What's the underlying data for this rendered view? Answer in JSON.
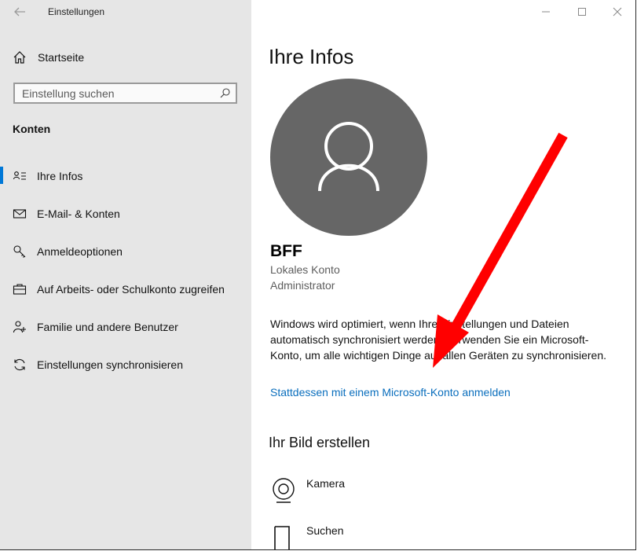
{
  "window": {
    "title": "Einstellungen"
  },
  "sidebar": {
    "home_label": "Startseite",
    "search_placeholder": "Einstellung suchen",
    "section_title": "Konten",
    "items": [
      {
        "label": "Ihre Infos",
        "icon": "person-card-icon",
        "active": true
      },
      {
        "label": "E-Mail- & Konten",
        "icon": "mail-icon",
        "active": false
      },
      {
        "label": "Anmeldeoptionen",
        "icon": "key-icon",
        "active": false
      },
      {
        "label": "Auf Arbeits- oder Schulkonto zugreifen",
        "icon": "briefcase-icon",
        "active": false
      },
      {
        "label": "Familie und andere Benutzer",
        "icon": "person-add-icon",
        "active": false
      },
      {
        "label": "Einstellungen synchronisieren",
        "icon": "sync-icon",
        "active": false
      }
    ]
  },
  "main": {
    "title": "Ihre Infos",
    "user_name": "BFF",
    "account_type": "Lokales Konto",
    "account_role": "Administrator",
    "description": "Windows wird optimiert, wenn Ihre Einstellungen und Dateien automatisch synchronisiert werden. Verwenden Sie ein Microsoft-Konto, um alle wichtigen Dinge auf allen Geräten zu synchronisieren.",
    "ms_link": "Stattdessen mit einem Microsoft-Konto anmelden",
    "create_picture_title": "Ihr Bild erstellen",
    "options": [
      {
        "label": "Kamera",
        "icon": "camera-icon"
      },
      {
        "label": "Suchen",
        "icon": "browse-icon"
      }
    ]
  },
  "colors": {
    "accent": "#0078d7",
    "link": "#0a6ebd",
    "avatar": "#666666",
    "annotation_arrow": "#ff0000"
  }
}
